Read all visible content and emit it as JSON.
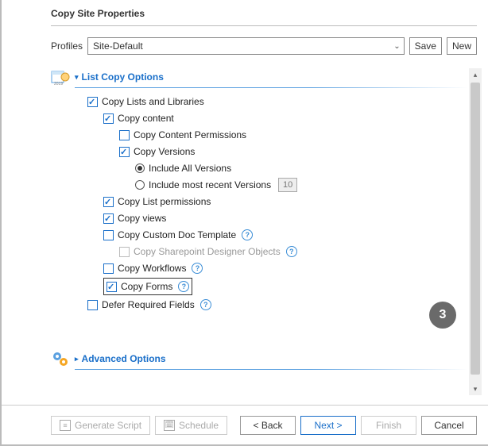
{
  "title": "Copy Site Properties",
  "profiles": {
    "label": "Profiles",
    "selected": "Site-Default",
    "save_label": "Save",
    "new_label": "New"
  },
  "section_list": {
    "title": "List Copy Options"
  },
  "opts": {
    "copy_lists": "Copy Lists and Libraries",
    "copy_content": "Copy content",
    "copy_content_perms": "Copy Content Permissions",
    "copy_versions": "Copy Versions",
    "include_all": "Include All Versions",
    "include_recent": "Include most recent Versions",
    "recent_count": "10",
    "copy_list_perms": "Copy List permissions",
    "copy_views": "Copy views",
    "copy_custom_tmpl": "Copy Custom Doc Template",
    "copy_spd": "Copy Sharepoint Designer Objects",
    "copy_workflows": "Copy Workflows",
    "copy_forms": "Copy Forms",
    "defer_required": "Defer Required Fields"
  },
  "section_advanced": {
    "title": "Advanced Options"
  },
  "step_badge": "3",
  "footer": {
    "generate_script": "Generate Script",
    "schedule": "Schedule",
    "back": "< Back",
    "next": "Next >",
    "finish": "Finish",
    "cancel": "Cancel"
  }
}
